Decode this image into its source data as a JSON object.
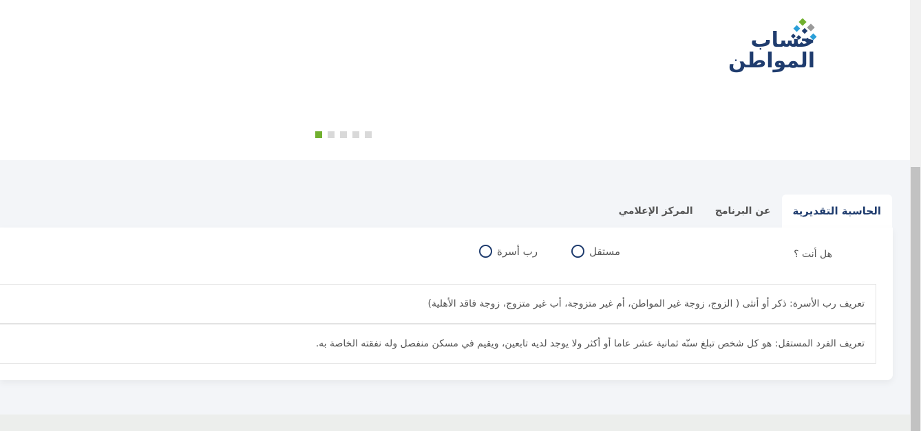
{
  "brand": {
    "line1": "حساب",
    "line2": "المواطن",
    "colors": [
      "#1f3c6e",
      "#71b02f",
      "#2a9fd8",
      "#9a9a9a"
    ]
  },
  "slider": {
    "dot_count": 5,
    "active_index": 0,
    "active_color": "#71b02f"
  },
  "tabs": [
    {
      "label": "الحاسبة التقديرية",
      "active": true
    },
    {
      "label": "عن البرنامج",
      "active": false
    },
    {
      "label": "المركز الإعلامي",
      "active": false
    }
  ],
  "calculator": {
    "question": "هل أنت ؟",
    "options": [
      {
        "label": "مستقل",
        "selected": false
      },
      {
        "label": "رب أسرة",
        "selected": false
      }
    ],
    "definitions": [
      "تعريف رب الأسرة: ذكر أو أنثى ( الزوج، زوجة غير المواطن، أم غير متزوجة، أب غير متزوج، زوجة فاقد الأهلية)",
      "تعريف الفرد المستقل: هو كل شخص تبلغ سنّه ثمانية عشر عاما أو أكثر ولا يوجد لديه تابعين، ويقيم في مسكن منفصل وله نفقته الخاصة به."
    ]
  }
}
